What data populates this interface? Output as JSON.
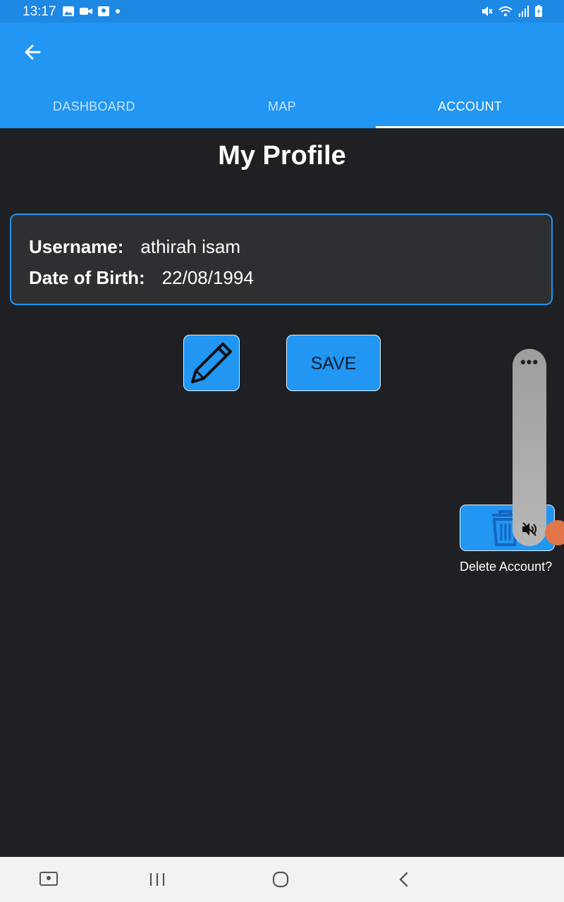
{
  "status_bar": {
    "time": "13:17",
    "left_icons": [
      "image-icon",
      "video-icon",
      "screen-share-icon",
      "dot-icon"
    ],
    "right_icons": [
      "mute-icon",
      "wifi-icon",
      "signal-icon",
      "battery-icon"
    ]
  },
  "app_bar": {
    "tabs": [
      {
        "label": "DASHBOARD",
        "active": false
      },
      {
        "label": "MAP",
        "active": false
      },
      {
        "label": "ACCOUNT",
        "active": true
      }
    ]
  },
  "profile": {
    "title": "My Profile",
    "username_label": "Username:",
    "username_value": "athirah isam",
    "dob_label": "Date of Birth:",
    "dob_value": "22/08/1994"
  },
  "actions": {
    "edit_icon": "pencil-icon",
    "save_label": "SAVE",
    "delete_icon": "trash-icon",
    "delete_label": "Delete Account?"
  },
  "volume_panel": {
    "more_label": "•••",
    "icon": "mute-icon"
  },
  "nav_bar": {
    "items": [
      "recent-screenshot-icon",
      "recents-icon",
      "home-icon",
      "back-icon"
    ]
  },
  "colors": {
    "primary": "#2196f3",
    "status_bar": "#1e88e5",
    "background": "#1f2023",
    "card": "#2e2f33"
  }
}
